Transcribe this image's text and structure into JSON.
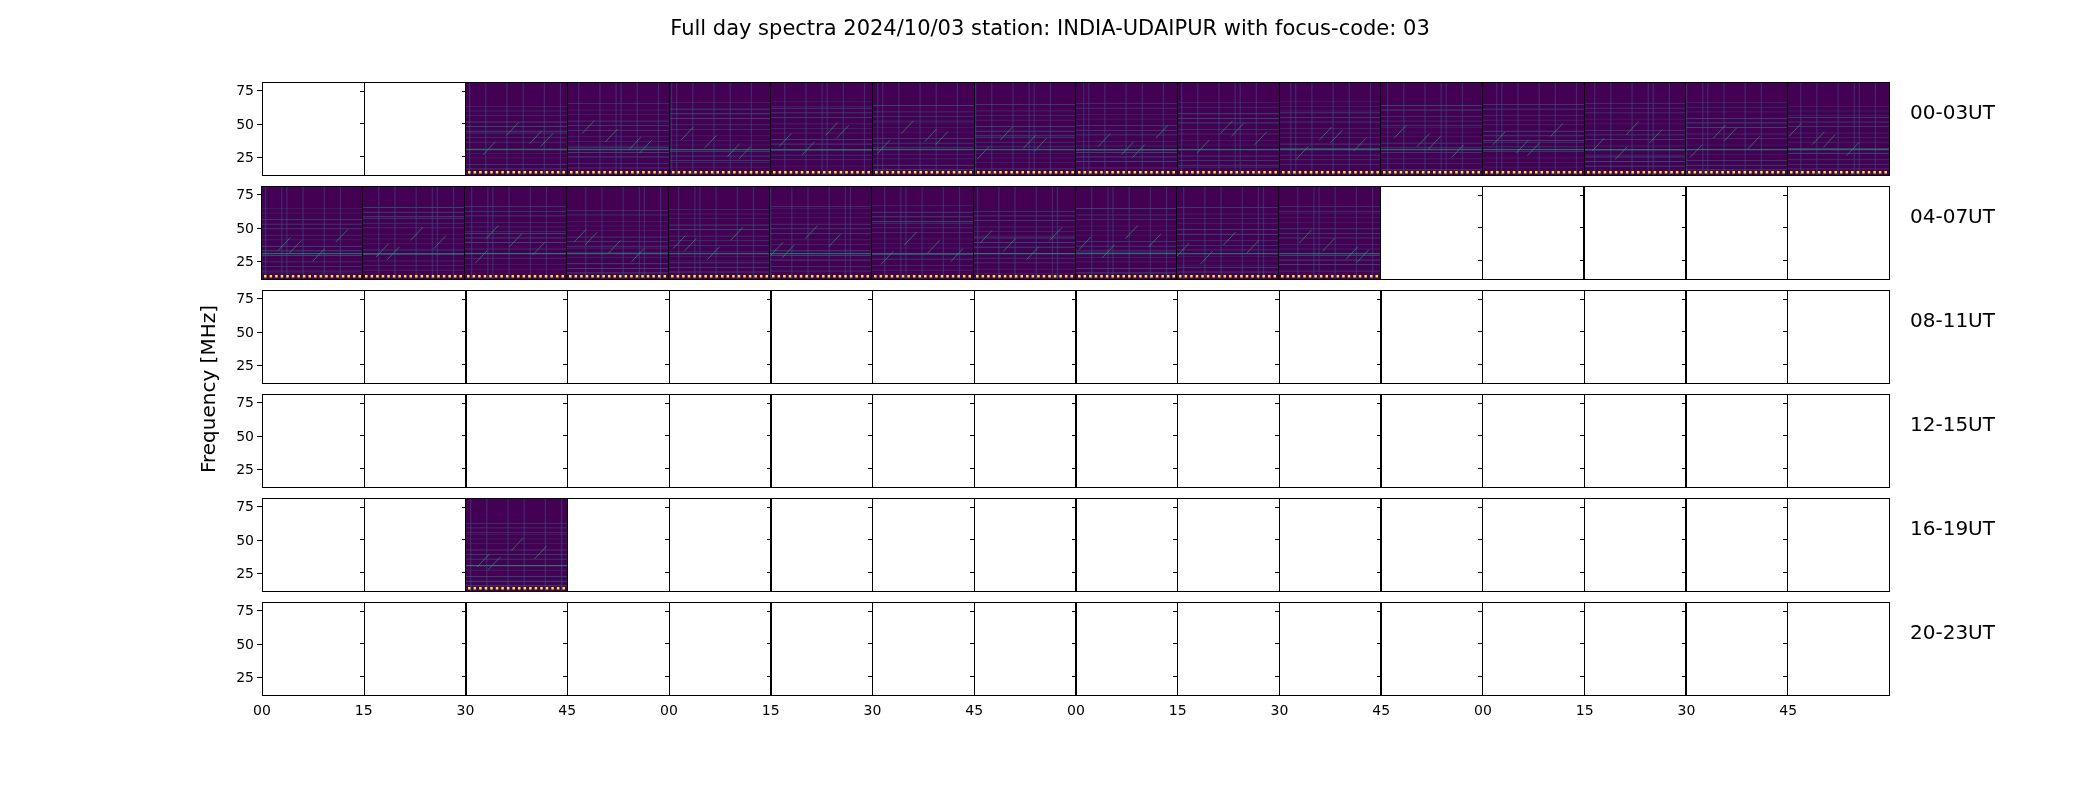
{
  "title": "Full day spectra 2024/10/03 station: INDIA-UDAIPUR with focus-code: 03",
  "ylabel": "Frequency [MHz]",
  "rows": [
    {
      "label": "00-03UT",
      "yticks": [
        "75",
        "50",
        "25"
      ],
      "panels": [
        {
          "kind": "empty"
        },
        {
          "kind": "empty"
        },
        {
          "kind": "spectrogram"
        },
        {
          "kind": "spectrogram"
        },
        {
          "kind": "spectrogram"
        },
        {
          "kind": "spectrogram"
        },
        {
          "kind": "spectrogram"
        },
        {
          "kind": "spectrogram"
        },
        {
          "kind": "spectrogram"
        },
        {
          "kind": "spectrogram"
        },
        {
          "kind": "spectrogram"
        },
        {
          "kind": "spectrogram"
        },
        {
          "kind": "spectrogram"
        },
        {
          "kind": "spectrogram"
        },
        {
          "kind": "spectrogram"
        },
        {
          "kind": "spectrogram"
        }
      ]
    },
    {
      "label": "04-07UT",
      "yticks": [
        "75",
        "50",
        "25"
      ],
      "panels": [
        {
          "kind": "spectrogram"
        },
        {
          "kind": "spectrogram"
        },
        {
          "kind": "spectrogram"
        },
        {
          "kind": "spectrogram"
        },
        {
          "kind": "spectrogram"
        },
        {
          "kind": "spectrogram"
        },
        {
          "kind": "spectrogram"
        },
        {
          "kind": "spectrogram"
        },
        {
          "kind": "spectrogram"
        },
        {
          "kind": "spectrogram"
        },
        {
          "kind": "spectrogram"
        },
        {
          "kind": "empty"
        },
        {
          "kind": "empty"
        },
        {
          "kind": "empty"
        },
        {
          "kind": "empty"
        },
        {
          "kind": "empty"
        }
      ]
    },
    {
      "label": "08-11UT",
      "yticks": [
        "75",
        "50",
        "25"
      ],
      "panels": [
        {
          "kind": "empty"
        },
        {
          "kind": "empty"
        },
        {
          "kind": "empty"
        },
        {
          "kind": "empty"
        },
        {
          "kind": "empty"
        },
        {
          "kind": "empty"
        },
        {
          "kind": "empty"
        },
        {
          "kind": "empty"
        },
        {
          "kind": "empty"
        },
        {
          "kind": "empty"
        },
        {
          "kind": "empty"
        },
        {
          "kind": "empty"
        },
        {
          "kind": "empty"
        },
        {
          "kind": "empty"
        },
        {
          "kind": "empty"
        },
        {
          "kind": "empty"
        }
      ]
    },
    {
      "label": "12-15UT",
      "yticks": [
        "75",
        "50",
        "25"
      ],
      "panels": [
        {
          "kind": "empty"
        },
        {
          "kind": "empty"
        },
        {
          "kind": "empty"
        },
        {
          "kind": "empty"
        },
        {
          "kind": "empty"
        },
        {
          "kind": "empty"
        },
        {
          "kind": "empty"
        },
        {
          "kind": "empty"
        },
        {
          "kind": "empty"
        },
        {
          "kind": "empty"
        },
        {
          "kind": "empty"
        },
        {
          "kind": "empty"
        },
        {
          "kind": "empty"
        },
        {
          "kind": "empty"
        },
        {
          "kind": "empty"
        },
        {
          "kind": "empty"
        }
      ]
    },
    {
      "label": "16-19UT",
      "yticks": [
        "75",
        "50",
        "25"
      ],
      "panels": [
        {
          "kind": "empty"
        },
        {
          "kind": "empty"
        },
        {
          "kind": "spectrogram"
        },
        {
          "kind": "empty"
        },
        {
          "kind": "empty"
        },
        {
          "kind": "empty"
        },
        {
          "kind": "empty"
        },
        {
          "kind": "empty"
        },
        {
          "kind": "empty"
        },
        {
          "kind": "empty"
        },
        {
          "kind": "empty"
        },
        {
          "kind": "empty"
        },
        {
          "kind": "empty"
        },
        {
          "kind": "empty"
        },
        {
          "kind": "empty"
        },
        {
          "kind": "empty"
        }
      ]
    },
    {
      "label": "20-23UT",
      "yticks": [
        "75",
        "50",
        "25"
      ],
      "panels": [
        {
          "kind": "empty"
        },
        {
          "kind": "empty"
        },
        {
          "kind": "empty"
        },
        {
          "kind": "empty"
        },
        {
          "kind": "empty"
        },
        {
          "kind": "empty"
        },
        {
          "kind": "empty"
        },
        {
          "kind": "empty"
        },
        {
          "kind": "empty"
        },
        {
          "kind": "empty"
        },
        {
          "kind": "empty"
        },
        {
          "kind": "empty"
        },
        {
          "kind": "empty"
        },
        {
          "kind": "empty"
        },
        {
          "kind": "empty"
        },
        {
          "kind": "empty"
        }
      ]
    }
  ],
  "xticks": [
    "00",
    "15",
    "30",
    "45",
    "00",
    "15",
    "30",
    "45",
    "00",
    "15",
    "30",
    "45",
    "00",
    "15",
    "30",
    "45"
  ]
}
